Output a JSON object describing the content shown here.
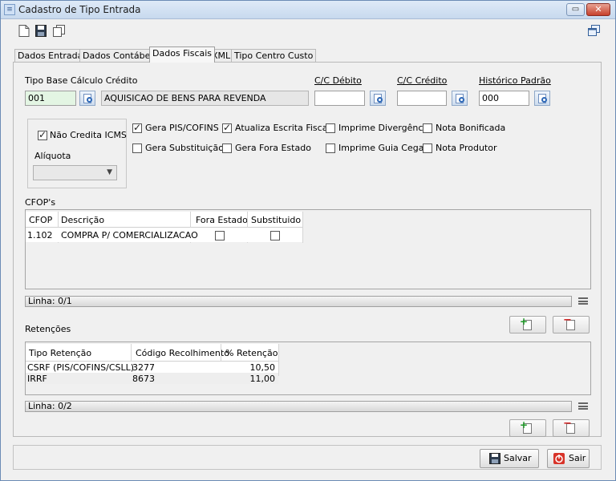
{
  "window": {
    "title": "Cadastro de Tipo Entrada",
    "min_glyph": "▭",
    "close_glyph": "✕"
  },
  "toolbar": {
    "icons": [
      "new-icon",
      "save-icon",
      "copy-icon",
      "windows-icon"
    ]
  },
  "tabs": [
    {
      "label": "Dados Entrada",
      "active": false
    },
    {
      "label": "Dados Contábeis",
      "active": false
    },
    {
      "label": "Dados Fiscais",
      "active": true
    },
    {
      "label": "XML",
      "active": false
    },
    {
      "label": "Tipo Centro Custo",
      "active": false
    }
  ],
  "fiscal": {
    "tipo_base_label": "Tipo Base Cálculo Crédito",
    "tipo_base_code": "001",
    "tipo_base_desc": "AQUISICAO DE BENS PARA REVENDA",
    "cc_debito_label": "C/C Débito",
    "cc_debito_value": "",
    "cc_credito_label": "C/C Crédito",
    "cc_credito_value": "",
    "historico_label": "Histórico Padrão",
    "historico_value": "000"
  },
  "icms": {
    "nao_credita_label": "Não Credita ICMS",
    "nao_credita_checked": true,
    "aliquota_label": "Alíquota",
    "aliquota_value": ""
  },
  "options": [
    {
      "label": "Gera PIS/COFINS",
      "checked": true
    },
    {
      "label": "Atualiza Escrita Fiscal",
      "checked": true
    },
    {
      "label": "Imprime Divergência",
      "checked": false
    },
    {
      "label": "Nota Bonificada",
      "checked": false
    },
    {
      "label": "Gera Substituição",
      "checked": false
    },
    {
      "label": "Gera Fora Estado",
      "checked": false
    },
    {
      "label": "Imprime Guia Cega",
      "checked": false
    },
    {
      "label": "Nota Produtor",
      "checked": false
    }
  ],
  "cfop": {
    "section_label": "CFOP's",
    "columns": [
      "CFOP",
      "Descrição",
      "Fora Estado",
      "Substituido"
    ],
    "rows": [
      {
        "cfop": "1.102",
        "descricao": "COMPRA P/ COMERCIALIZACAO",
        "fora_estado": false,
        "substituido": false
      }
    ],
    "status": "Linha: 0/1"
  },
  "retencoes": {
    "section_label": "Retenções",
    "columns": [
      "Tipo Retenção",
      "Código Recolhimento",
      "% Retenção"
    ],
    "rows": [
      {
        "tipo": "CSRF (PIS/COFINS/CSLL)",
        "codigo": "3277",
        "percent": "10,50"
      },
      {
        "tipo": "IRRF",
        "codigo": "8673",
        "percent": "11,00"
      }
    ],
    "status": "Linha: 0/2"
  },
  "actions": {
    "salvar": "Salvar",
    "sair": "Sair"
  }
}
